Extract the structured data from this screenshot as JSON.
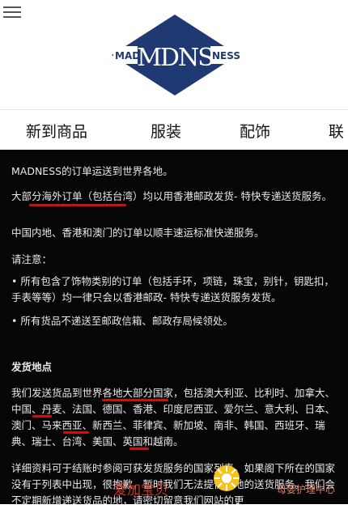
{
  "brand": {
    "logo_left": "MAD",
    "logo_center": "MDNS",
    "logo_right": "NESS"
  },
  "nav": {
    "items": [
      "新到商品",
      "服装",
      "配饰",
      "联"
    ]
  },
  "content": {
    "intro": "MADNESS的订单运送到世界各地。",
    "overseas": "大部分海外订单（包括台湾）均以用香港邮政发货- 特快专递送货服务。",
    "mainland": "中国内地、香港和澳门的订单以顺丰速运标准快递服务。",
    "notice_title": "请注意：",
    "notice_1": "• 所有包含了饰物类别的订单（包括手环，项链，珠宝，别针，钥匙扣，手表等等）均一律只会以香港邮政- 特快专递送货服务发货。",
    "notice_2": "• 所有货品不递送至邮政信箱、邮政存局候领处。",
    "destinations_title": "发货地点",
    "destinations": "我们发送货品到世界各地大部分国家，包括澳大利亚、比利时、加拿大、中国、丹麦、法国、德国、香港、印度尼西亚、爱尔兰、意大利、日本、澳门、马来西亚、新西兰、菲律宾、新加坡、南非、韩国、西班牙、瑞典、瑞士、台湾、美国、英国和越南。",
    "details": "详细资料可于结账时参阅可获发货服务的国家列表。如果阁下所在的国家没有于列表中出现，很抱歉，暂时我们无法提供当地的送货服务。我们会不定期新增递送货品的地，请密切留意我们网站的更"
  },
  "watermark": {
    "left_text": "爱加宝贝",
    "right_text": "母婴护理中心"
  },
  "colors": {
    "underline": "#cc1010",
    "content_bg": "#060606",
    "logo_blue": "#1f3a72"
  },
  "icons": [
    "menu-icon",
    "brand-logo"
  ]
}
